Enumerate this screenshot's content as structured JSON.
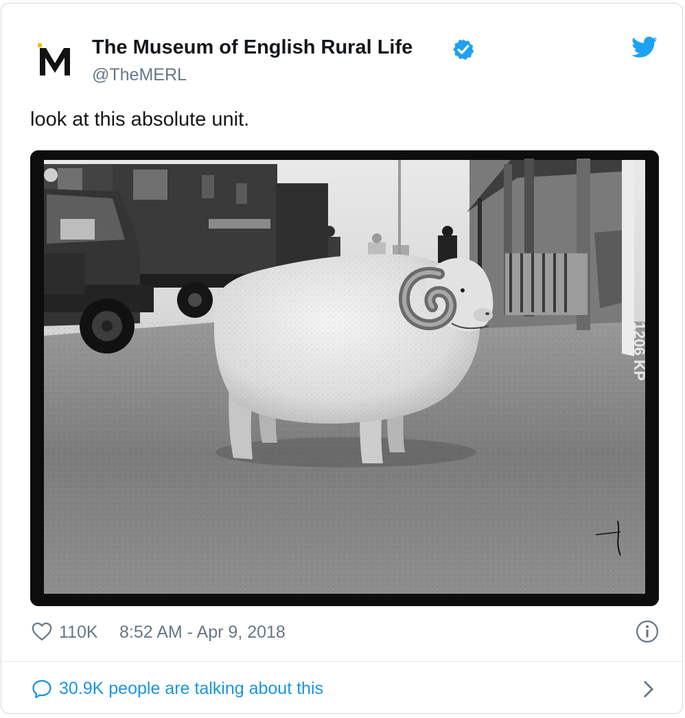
{
  "author": {
    "name": "The Museum of English Rural Life",
    "handle": "@TheMERL",
    "logo_letter": "M",
    "verified": true
  },
  "tweet": {
    "text": "look at this absolute unit.",
    "likes": "110K",
    "timestamp": "8:52 AM - Apr 9, 2018"
  },
  "conversation": {
    "label": "30.9K people are talking about this"
  },
  "photo": {
    "archive_number": "1206 KP"
  },
  "icons": {
    "heart": "heart-icon",
    "info": "info-icon",
    "bubble": "speech-bubble-icon",
    "chevron": "chevron-right-icon",
    "twitter": "twitter-bird-icon",
    "verified": "verified-badge-icon"
  },
  "colors": {
    "name_text": "#14171a",
    "secondary_text": "#657786",
    "link_blue": "#1b95e0",
    "twitter_blue": "#1da1f2",
    "border": "#d3d8dc"
  }
}
